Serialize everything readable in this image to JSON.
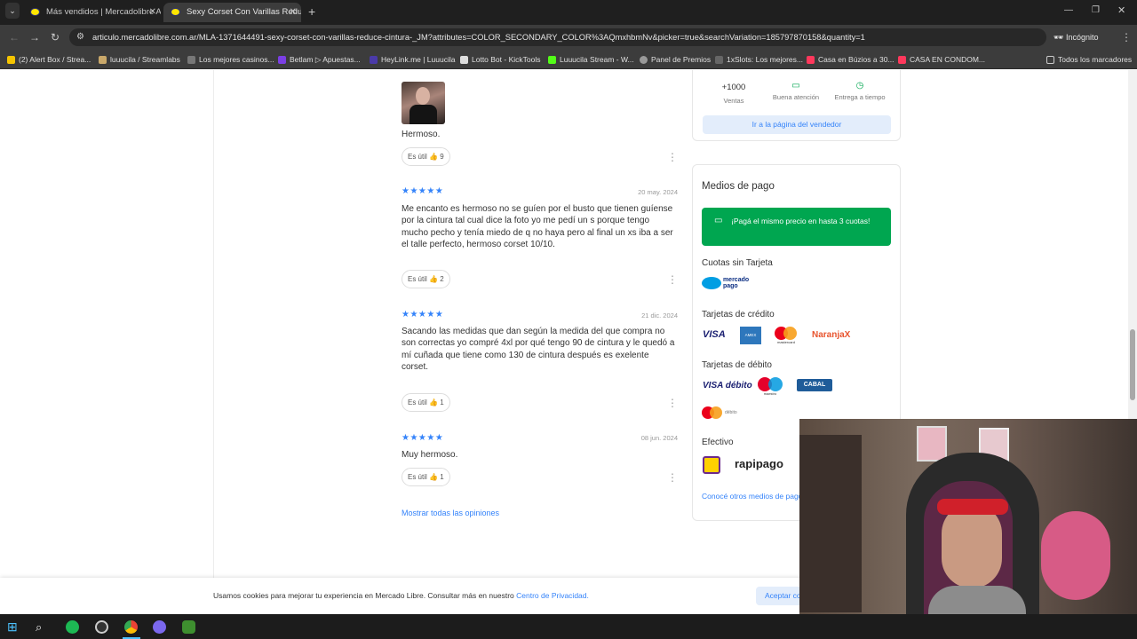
{
  "browser": {
    "tabs": [
      {
        "title": "Más vendidos | Mercadolibre Ar",
        "active": false
      },
      {
        "title": "Sexy Corset Con Varillas Reduce",
        "active": true
      }
    ],
    "url": "articulo.mercadolibre.com.ar/MLA-1371644491-sexy-corset-con-varillas-reduce-cintura-_JM?attributes=COLOR_SECONDARY_COLOR%3AQmxhbmNv&picker=true&searchVariation=185797870158&quantity=1",
    "profile": "Incógnito",
    "bookmarks": [
      "(2) Alert Box / Strea...",
      "luuucila / Streamlabs",
      "Los mejores casinos...",
      "Betlam ▷ Apuestas...",
      "HeyLink.me | Luuucila",
      "Lotto Bot - KickTools",
      "Luuucila Stream - W...",
      "Panel de Premios",
      "1xSlots: Los mejores...",
      "Casa en Búzios a 30...",
      "CASA EN CONDOM..."
    ],
    "all_bookmarks": "Todos los marcadores"
  },
  "reviews": [
    {
      "text": "Hermoso.",
      "date": "",
      "useful_label": "Es útil",
      "useful_count": "9"
    },
    {
      "text": "Me encanto es hermoso no se guíen por el busto que tienen guíense por la cintura tal cual dice la foto yo me pedí un s porque tengo mucho pecho y tenía miedo de q no haya pero al final un xs iba a ser el talle perfecto, hermoso corset 10/10.",
      "date": "20 may. 2024",
      "useful_label": "Es útil",
      "useful_count": "2"
    },
    {
      "text": "Sacando las medidas que dan según la medida del que compra no son correctas yo compré 4xl por qué tengo 90 de cintura y le quedó a mí cuñada que tiene como 130 de cintura después es exelente corset.",
      "date": "21 dic. 2024",
      "useful_label": "Es útil",
      "useful_count": "1"
    },
    {
      "text": "Muy hermoso.",
      "date": "08 jun. 2024",
      "useful_label": "Es útil",
      "useful_count": "1"
    }
  ],
  "show_all": "Mostrar todas las opiniones",
  "seller": {
    "stats": [
      {
        "value": "+1000",
        "label": "Ventas"
      },
      {
        "value": "",
        "label": "Buena atención"
      },
      {
        "value": "",
        "label": "Entrega a tiempo"
      }
    ],
    "page_button": "Ir a la página del vendedor"
  },
  "payment": {
    "title": "Medios de pago",
    "banner": "¡Pagá el mismo precio en hasta 3 cuotas!",
    "no_card": "Cuotas sin Tarjeta",
    "mp_logo": "mercado pago",
    "credit": "Tarjetas de crédito",
    "credit_brands": [
      "VISA",
      "AMEX",
      "mastercard",
      "NaranjaX"
    ],
    "debit": "Tarjetas de débito",
    "debit_brands": [
      "VISA débito",
      "maestro",
      "CABAL"
    ],
    "mc_debit": "débito",
    "cash": "Efectivo",
    "cash_brand": "rapipago",
    "other": "Conocé otros medios de pago"
  },
  "cookie": {
    "text": "Usamos cookies para mejorar tu experiencia en Mercado Libre. Consultar más en nuestro",
    "link": "Centro de Privacidad.",
    "accept": "Aceptar cookies"
  },
  "colors": {
    "accent": "#3483fa",
    "green": "#00a650",
    "brand_yellow": "#ffe600"
  }
}
